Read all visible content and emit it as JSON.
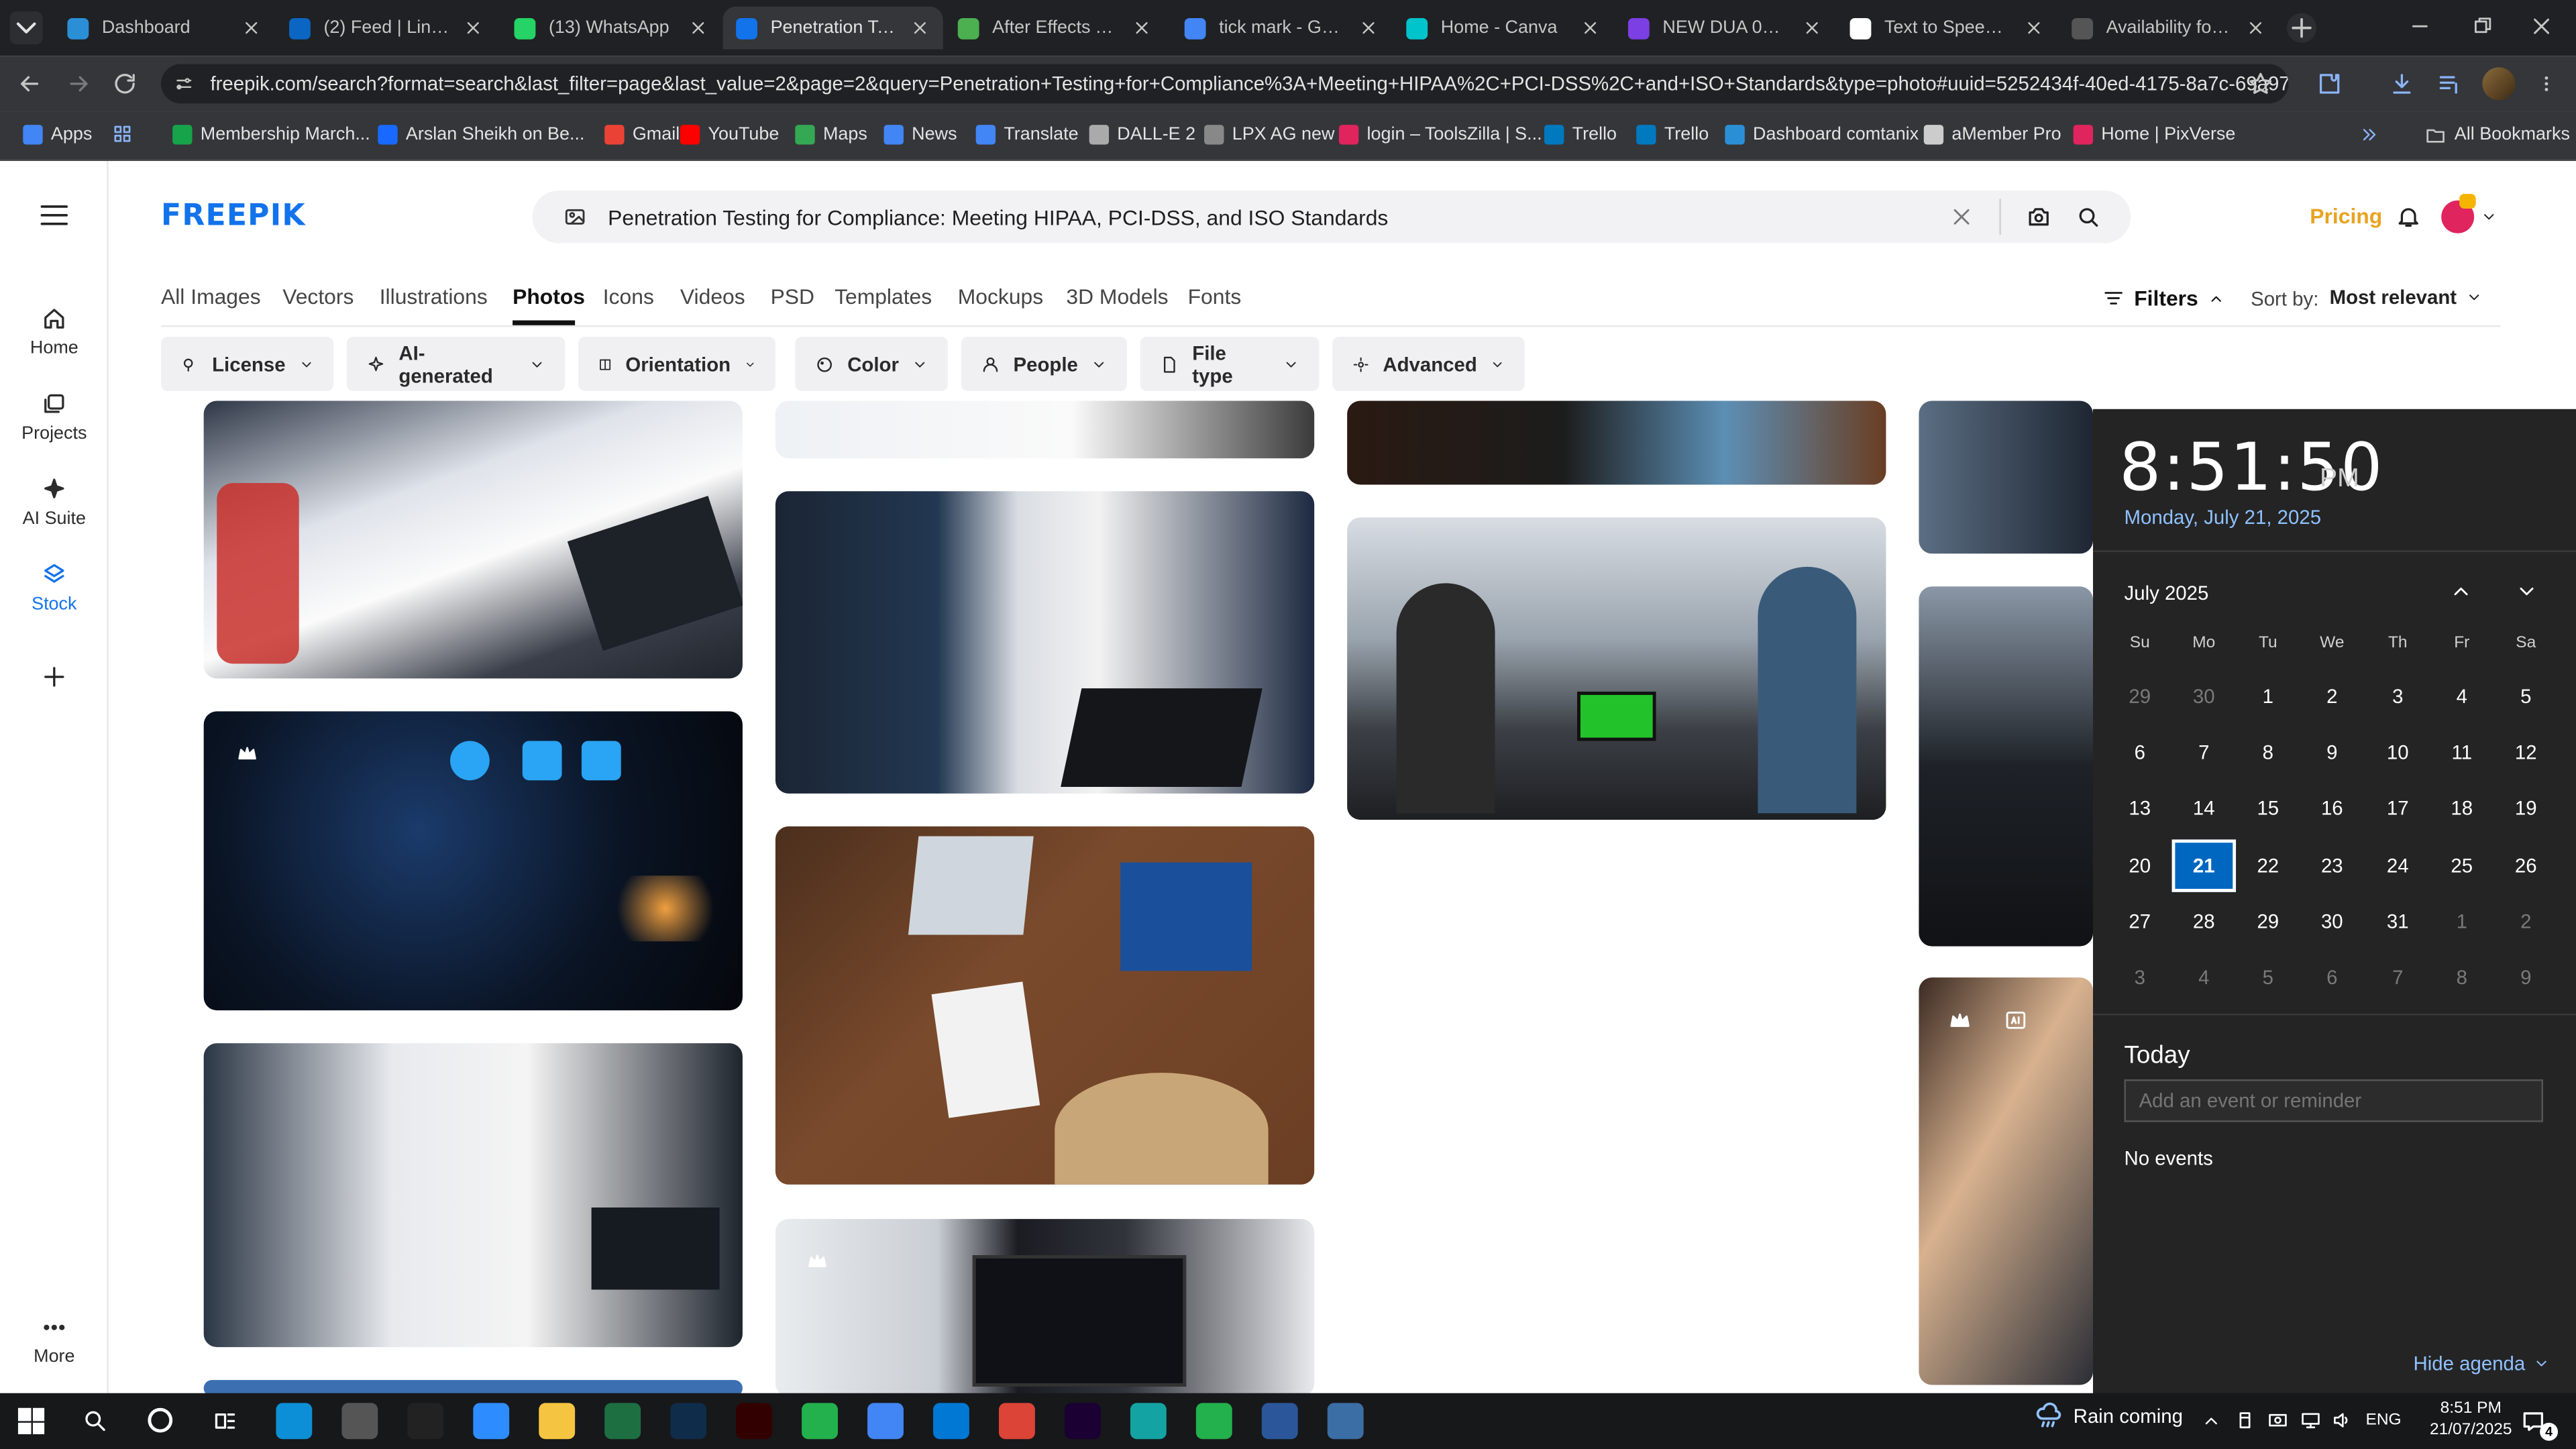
{
  "browser": {
    "tabs": [
      {
        "title": "Dashboard",
        "color": "#2b8fd6",
        "active": false
      },
      {
        "title": "(2) Feed | LinkedIn",
        "color": "#0a66c2",
        "active": false
      },
      {
        "title": "(13) WhatsApp",
        "color": "#25d366",
        "active": false
      },
      {
        "title": "Penetration Testi",
        "color": "#1273eb",
        "active": true
      },
      {
        "title": "After Effects Temp",
        "color": "#4caf50",
        "active": false
      },
      {
        "title": "tick mark - Googl",
        "color": "#4285f4",
        "active": false
      },
      {
        "title": "Home - Canva",
        "color": "#00c4cc",
        "active": false
      },
      {
        "title": "NEW DUA 02 - M",
        "color": "#7b3fe4",
        "active": false
      },
      {
        "title": "Text to Speech | E",
        "color": "#ffffff",
        "active": false
      },
      {
        "title": "Availability for ES",
        "color": "#555555",
        "active": false
      }
    ],
    "url": "freepik.com/search?format=search&last_filter=page&last_value=2&page=2&query=Penetration+Testing+for+Compliance%3A+Meeting+HIPAA%2C+PCI-DSS%2C+and+ISO+Standards&type=photo#uuid=5252434f-40ed-4175-8a7c-69a97cc...",
    "bookmarks": [
      {
        "label": "Apps",
        "color": "#4285f4"
      },
      {
        "label": "Membership March...",
        "color": "#17a34a"
      },
      {
        "label": "Arslan Sheikh on Be...",
        "color": "#1769ff"
      },
      {
        "label": "Gmail",
        "color": "#ea4335"
      },
      {
        "label": "YouTube",
        "color": "#ff0000"
      },
      {
        "label": "Maps",
        "color": "#34a853"
      },
      {
        "label": "News",
        "color": "#4285f4"
      },
      {
        "label": "Translate",
        "color": "#4285f4"
      },
      {
        "label": "DALL-E 2",
        "color": "#aaaaaa"
      },
      {
        "label": "LPX AG new",
        "color": "#888888"
      },
      {
        "label": "login – ToolsZilla | S...",
        "color": "#e0245e"
      },
      {
        "label": "Trello",
        "color": "#0079bf"
      },
      {
        "label": "Trello",
        "color": "#0079bf"
      },
      {
        "label": "Dashboard comtanix",
        "color": "#2b8fd6"
      },
      {
        "label": "aMember Pro",
        "color": "#cccccc"
      },
      {
        "label": "Home | PixVerse",
        "color": "#e0245e"
      }
    ],
    "all_bookmarks": "All Bookmarks"
  },
  "site": {
    "logo": "FREEPIK",
    "search_query": "Penetration Testing for Compliance: Meeting HIPAA, PCI-DSS, and ISO Standards",
    "pricing": "Pricing",
    "sidebar": [
      {
        "label": "Home",
        "icon": "home-icon"
      },
      {
        "label": "Projects",
        "icon": "projects-icon"
      },
      {
        "label": "AI Suite",
        "icon": "ai-suite-icon"
      },
      {
        "label": "Stock",
        "icon": "stock-icon"
      }
    ],
    "more": "More",
    "nav_tabs": [
      "All Images",
      "Vectors",
      "Illustrations",
      "Photos",
      "Icons",
      "Videos",
      "PSD",
      "Templates",
      "Mockups",
      "3D Models",
      "Fonts"
    ],
    "active_tab": "Photos",
    "filters_label": "Filters",
    "sort_label": "Sort by:",
    "sort_value": "Most relevant",
    "filter_buttons": [
      "License",
      "AI-generated",
      "Orientation",
      "Color",
      "People",
      "File type",
      "Advanced"
    ]
  },
  "calendar": {
    "time": "8:51:50",
    "ampm": "PM",
    "date": "Monday, July 21, 2025",
    "month": "July 2025",
    "weekdays": [
      "Su",
      "Mo",
      "Tu",
      "We",
      "Th",
      "Fr",
      "Sa"
    ],
    "days": [
      [
        "29",
        "30",
        "1",
        "2",
        "3",
        "4",
        "5"
      ],
      [
        "6",
        "7",
        "8",
        "9",
        "10",
        "11",
        "12"
      ],
      [
        "13",
        "14",
        "15",
        "16",
        "17",
        "18",
        "19"
      ],
      [
        "20",
        "21",
        "22",
        "23",
        "24",
        "25",
        "26"
      ],
      [
        "27",
        "28",
        "29",
        "30",
        "31",
        "1",
        "2"
      ],
      [
        "3",
        "4",
        "5",
        "6",
        "7",
        "8",
        "9"
      ]
    ],
    "selected_day": "21",
    "today_label": "Today",
    "event_placeholder": "Add an event or reminder",
    "no_events": "No events",
    "hide_agenda": "Hide agenda"
  },
  "taskbar": {
    "weather": "Rain coming",
    "lang": "ENG",
    "time": "8:51 PM",
    "date": "21/07/2025",
    "notifications": "4"
  }
}
